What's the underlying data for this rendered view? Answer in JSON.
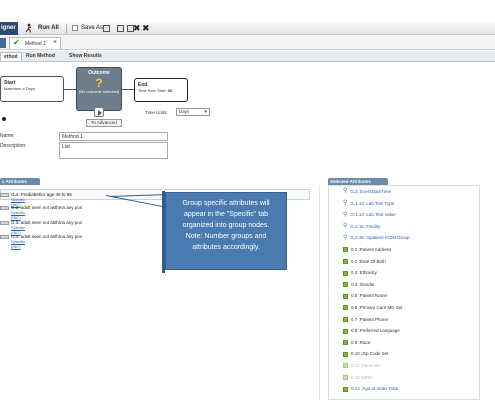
{
  "toolbar": {
    "app_tab": "igner",
    "run_all": "Run All",
    "save_as": "Save As"
  },
  "method_tab": {
    "label": "Method 1"
  },
  "sub_tabs": [
    "ethod",
    "Run Method",
    "Show Results"
  ],
  "workflow": {
    "start": {
      "title": "Start",
      "subtitle": "Maximum # Days"
    },
    "outcome": {
      "title": "Outcome",
      "symbol": "?",
      "subtitle": "(No outcome selected)"
    },
    "end": {
      "title": "End",
      "subtitle": "Time from Start:",
      "value": "30"
    },
    "time_units_label": "Time Units:",
    "time_units_value": "Days",
    "advanced_button": "To Advanced"
  },
  "form": {
    "name_label": "Name:",
    "name_value": "Method 1",
    "description_label": "Description:",
    "description_value": "List"
  },
  "left_panel": {
    "title": "c Attributes",
    "items": [
      {
        "text": "G.4: Prediabetics age 40 to 65",
        "link": "Specific (INC)"
      },
      {
        "text": "G.2: adult seen not asthma any pos",
        "link": "Specific (INC)"
      },
      {
        "text": "G.3: adult seen not asthma any pos",
        "link": "Specific (INC)"
      },
      {
        "text": "G.4: adult seen not asthma any pos",
        "link": "Specific (INC)"
      }
    ]
  },
  "callout": {
    "text": "Group specific attributes will appear in the \"Specific\" tab organized into group nodes. Note: Number groups and attributes accordingly."
  },
  "right_panel": {
    "title": "Selected Attributes",
    "items": [
      {
        "text": "G.3 :EventDateTime",
        "style": "blue",
        "icon": "blue"
      },
      {
        "text": "G.1.13 :Lab Test Type",
        "style": "blue",
        "icon": "blue"
      },
      {
        "text": "G.1.14 :Lab Test Value",
        "style": "blue",
        "icon": "blue"
      },
      {
        "text": "G.2.16 :Facility",
        "style": "blue",
        "icon": "blue"
      },
      {
        "text": "G.2.38 :Inpatient ICDN Group",
        "style": "blue",
        "icon": "blue"
      },
      {
        "text": "0.1 :Patient Address",
        "style": "dark",
        "icon": "green"
      },
      {
        "text": "0.2 :Date Of Birth",
        "style": "dark",
        "icon": "green"
      },
      {
        "text": "0.3 :Ethnicity",
        "style": "dark",
        "icon": "green"
      },
      {
        "text": "0.4 :Gender",
        "style": "dark",
        "icon": "green"
      },
      {
        "text": "0.5 :Patient Name",
        "style": "dark",
        "icon": "green"
      },
      {
        "text": "0.6 :Primary Care MD Set",
        "style": "dark",
        "icon": "green"
      },
      {
        "text": "0.7 :Patient Phone",
        "style": "dark",
        "icon": "green"
      },
      {
        "text": "0.8 :Preferred Language",
        "style": "dark",
        "icon": "green"
      },
      {
        "text": "0.9 :Race",
        "style": "dark",
        "icon": "green"
      },
      {
        "text": "0.10 :Zip Code Set",
        "style": "dark",
        "icon": "green"
      },
      {
        "text": "0.11 :PatientID",
        "style": "faded",
        "icon": "lgreen"
      },
      {
        "text": "0.12 :MRN",
        "style": "faded",
        "icon": "lgreen"
      },
      {
        "text": "0.14 :Age at Index Date",
        "style": "blue",
        "icon": "green"
      }
    ]
  },
  "colors": {
    "app_tab": "#2b4a6f",
    "panel_header": "#6c8ba6",
    "callout_bg": "#4a7bb0",
    "link_blue": "#2a5fb0",
    "green_icon": "#7cbb3c"
  }
}
